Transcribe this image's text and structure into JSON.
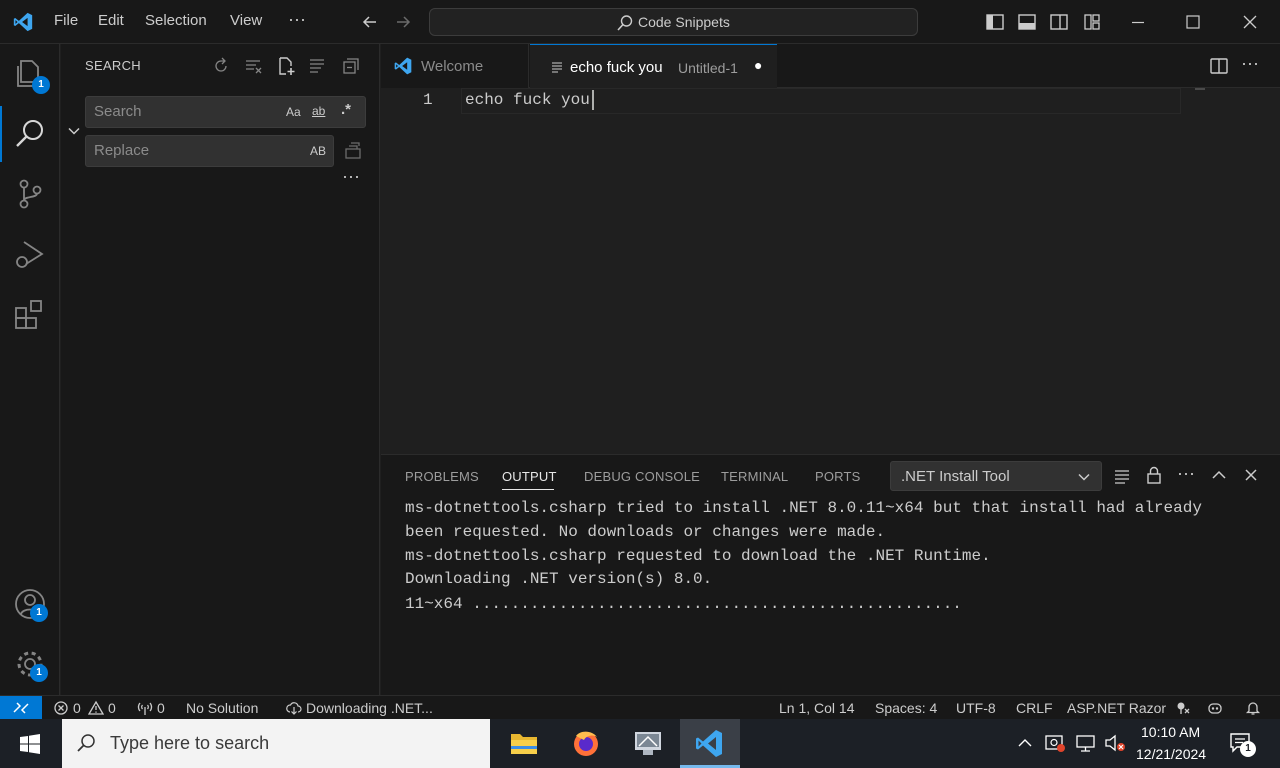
{
  "menu": {
    "file": "File",
    "edit": "Edit",
    "selection": "Selection",
    "view": "View",
    "more": "···"
  },
  "command_center": {
    "label": "Code Snippets"
  },
  "activity": {
    "explorer_badge": "1",
    "accounts_badge": "1",
    "settings_badge": "1"
  },
  "sidebar": {
    "title": "SEARCH",
    "search_placeholder": "Search",
    "replace_placeholder": "Replace",
    "opt_case": "Aa",
    "opt_word": "ab",
    "opt_regex": ".*",
    "opt_preserve": "AB",
    "more": "···"
  },
  "tabs": [
    {
      "label": "Welcome"
    },
    {
      "label": "echo fuck you",
      "description": "Untitled-1",
      "dirty": "●"
    }
  ],
  "editor": {
    "line_number": "1",
    "line_text": "echo fuck you"
  },
  "panel": {
    "tabs": [
      "PROBLEMS",
      "OUTPUT",
      "DEBUG CONSOLE",
      "TERMINAL",
      "PORTS"
    ],
    "channel": ".NET Install Tool",
    "output_lines": [
      "ms-dotnettools.csharp tried to install .NET 8.0.11~x64 but that install had already",
      "been requested. No downloads or changes were made.",
      "ms-dotnettools.csharp requested to download the .NET Runtime.",
      "Downloading .NET version(s) 8.0.",
      "11~x64 ..................................................."
    ]
  },
  "statusbar": {
    "errors": "0",
    "warnings": "0",
    "ports": "0",
    "solution": "No Solution",
    "download": "Downloading .NET...",
    "cursor": "Ln 1, Col 14",
    "spaces": "Spaces: 4",
    "encoding": "UTF-8",
    "eol": "CRLF",
    "language": "ASP.NET Razor"
  },
  "taskbar": {
    "search_placeholder": "Type here to search",
    "time": "10:10 AM",
    "date": "12/21/2024",
    "notification_count": "1"
  },
  "colors": {
    "accent": "#0078d4",
    "titlebar": "#181818",
    "editor_bg": "#1f1f1f"
  }
}
